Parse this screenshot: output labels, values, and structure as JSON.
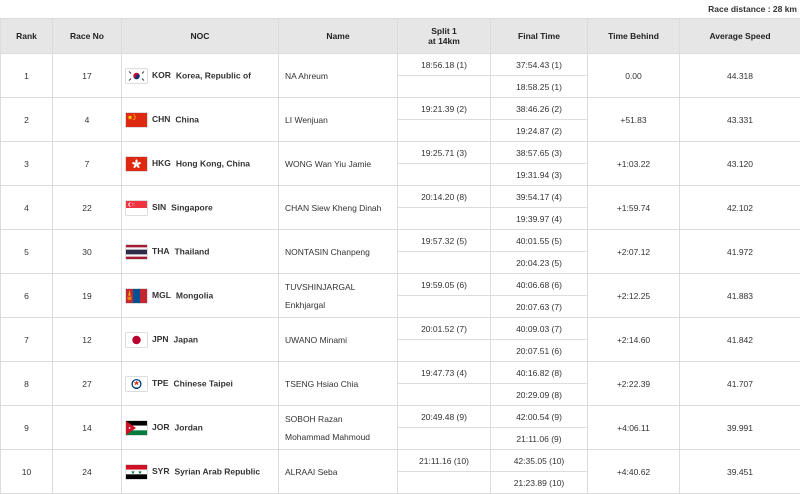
{
  "race_distance": "Race distance : 28 km",
  "headers": {
    "rank": "Rank",
    "race_no": "Race No",
    "noc": "NOC",
    "name": "Name",
    "split_line1": "Split 1",
    "split_line2": "at 14km",
    "final_time": "Final Time",
    "time_behind": "Time Behind",
    "avg_speed": "Average Speed"
  },
  "rows": [
    {
      "rank": "1",
      "race_no": "17",
      "flag": "kor-flag-icon",
      "noc": "KOR",
      "country": "Korea, Republic of",
      "name1": "NA Ahreum",
      "name2": "",
      "split": "18:56.18 (1)",
      "final1": "37:54.43 (1)",
      "final2": "18:58.25 (1)",
      "behind": "0.00",
      "speed": "44.318"
    },
    {
      "rank": "2",
      "race_no": "4",
      "flag": "chn-flag-icon",
      "noc": "CHN",
      "country": "China",
      "name1": "LI Wenjuan",
      "name2": "",
      "split": "19:21.39 (2)",
      "final1": "38:46.26 (2)",
      "final2": "19:24.87 (2)",
      "behind": "+51.83",
      "speed": "43.331"
    },
    {
      "rank": "3",
      "race_no": "7",
      "flag": "hkg-flag-icon",
      "noc": "HKG",
      "country": "Hong Kong, China",
      "name1": "WONG Wan Yiu Jamie",
      "name2": "",
      "split": "19:25.71 (3)",
      "final1": "38:57.65 (3)",
      "final2": "19:31.94 (3)",
      "behind": "+1:03.22",
      "speed": "43.120"
    },
    {
      "rank": "4",
      "race_no": "22",
      "flag": "sin-flag-icon",
      "noc": "SIN",
      "country": "Singapore",
      "name1": "CHAN Siew Kheng Dinah",
      "name2": "",
      "split": "20:14.20 (8)",
      "final1": "39:54.17 (4)",
      "final2": "19:39.97 (4)",
      "behind": "+1:59.74",
      "speed": "42.102"
    },
    {
      "rank": "5",
      "race_no": "30",
      "flag": "tha-flag-icon",
      "noc": "THA",
      "country": "Thailand",
      "name1": "NONTASIN Chanpeng",
      "name2": "",
      "split": "19:57.32 (5)",
      "final1": "40:01.55 (5)",
      "final2": "20:04.23 (5)",
      "behind": "+2:07.12",
      "speed": "41.972"
    },
    {
      "rank": "6",
      "race_no": "19",
      "flag": "mgl-flag-icon",
      "noc": "MGL",
      "country": "Mongolia",
      "name1": "TUVSHINJARGAL",
      "name2": "Enkhjargal",
      "split": "19:59.05 (6)",
      "final1": "40:06.68 (6)",
      "final2": "20:07.63 (7)",
      "behind": "+2:12.25",
      "speed": "41.883"
    },
    {
      "rank": "7",
      "race_no": "12",
      "flag": "jpn-flag-icon",
      "noc": "JPN",
      "country": "Japan",
      "name1": "UWANO Minami",
      "name2": "",
      "split": "20:01.52 (7)",
      "final1": "40:09.03 (7)",
      "final2": "20:07.51 (6)",
      "behind": "+2:14.60",
      "speed": "41.842"
    },
    {
      "rank": "8",
      "race_no": "27",
      "flag": "tpe-flag-icon",
      "noc": "TPE",
      "country": "Chinese Taipei",
      "name1": "TSENG Hsiao Chia",
      "name2": "",
      "split": "19:47.73 (4)",
      "final1": "40:16.82 (8)",
      "final2": "20:29.09 (8)",
      "behind": "+2:22.39",
      "speed": "41.707"
    },
    {
      "rank": "9",
      "race_no": "14",
      "flag": "jor-flag-icon",
      "noc": "JOR",
      "country": "Jordan",
      "name1": "SOBOH Razan",
      "name2": "Mohammad Mahmoud",
      "split": "20:49.48 (9)",
      "final1": "42:00.54 (9)",
      "final2": "21:11.06 (9)",
      "behind": "+4:06.11",
      "speed": "39.991"
    },
    {
      "rank": "10",
      "race_no": "24",
      "flag": "syr-flag-icon",
      "noc": "SYR",
      "country": "Syrian Arab Republic",
      "name1": "ALRAAI Seba",
      "name2": "",
      "split": "21:11.16 (10)",
      "final1": "42:35.05 (10)",
      "final2": "21:23.89 (10)",
      "behind": "+4:40.62",
      "speed": "39.451"
    }
  ]
}
